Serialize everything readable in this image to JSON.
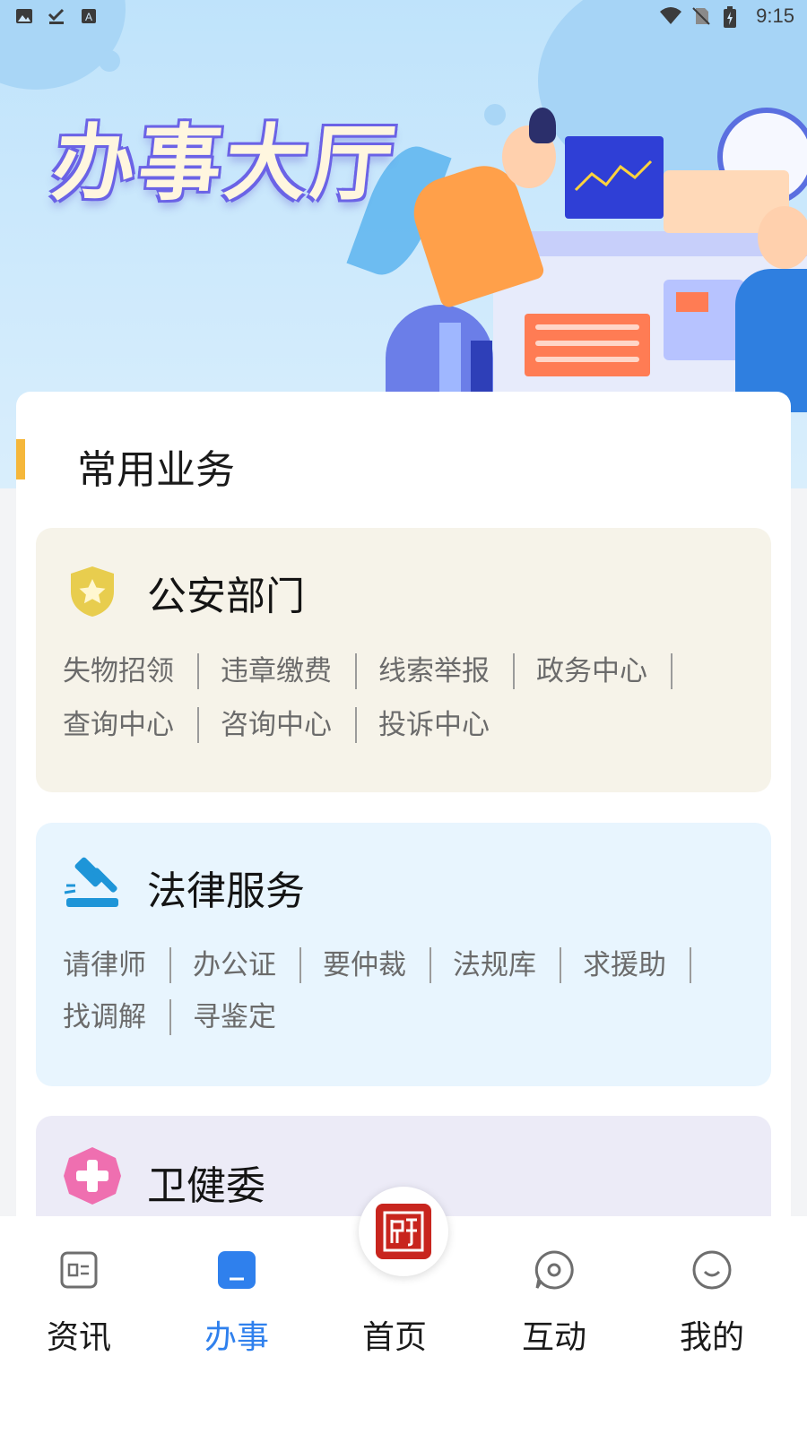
{
  "status_bar": {
    "time": "9:15",
    "left_icons": [
      "image-icon",
      "download-done-icon",
      "app-a-icon"
    ],
    "right_icons": [
      "wifi-icon",
      "no-sim-icon",
      "battery-charging-icon"
    ]
  },
  "hero": {
    "title": "办事大厅"
  },
  "common_section": {
    "title": "常用业务",
    "accent_color": "#f5b73b"
  },
  "departments": [
    {
      "name": "公安部门",
      "icon": "police-badge-icon",
      "icon_color": "#e8cd4e",
      "bg_color": "#f6f3e9",
      "links_row1": [
        "失物招领",
        "违章缴费",
        "线索举报",
        "政务中心"
      ],
      "links_row2": [
        "查询中心",
        "咨询中心",
        "投诉中心"
      ]
    },
    {
      "name": "法律服务",
      "icon": "gavel-icon",
      "icon_color": "#1e95d8",
      "bg_color": "#e8f5fe",
      "links_row1": [
        "请律师",
        "办公证",
        "要仲裁",
        "法规库",
        "求援助"
      ],
      "links_row2": [
        "找调解",
        "寻鉴定"
      ]
    },
    {
      "name": "卫健委",
      "icon": "medical-cross-icon",
      "icon_color": "#ef6fb0",
      "bg_color": "#ecebf7"
    }
  ],
  "bottom_nav": {
    "items": [
      {
        "label": "资讯",
        "icon": "news-icon"
      },
      {
        "label": "办事",
        "icon": "affairs-icon",
        "active": true
      },
      {
        "label": "首页",
        "icon": "seal-logo-icon"
      },
      {
        "label": "互动",
        "icon": "chat-icon"
      },
      {
        "label": "我的",
        "icon": "smile-profile-icon"
      }
    ],
    "active_color": "#2f80ed"
  }
}
